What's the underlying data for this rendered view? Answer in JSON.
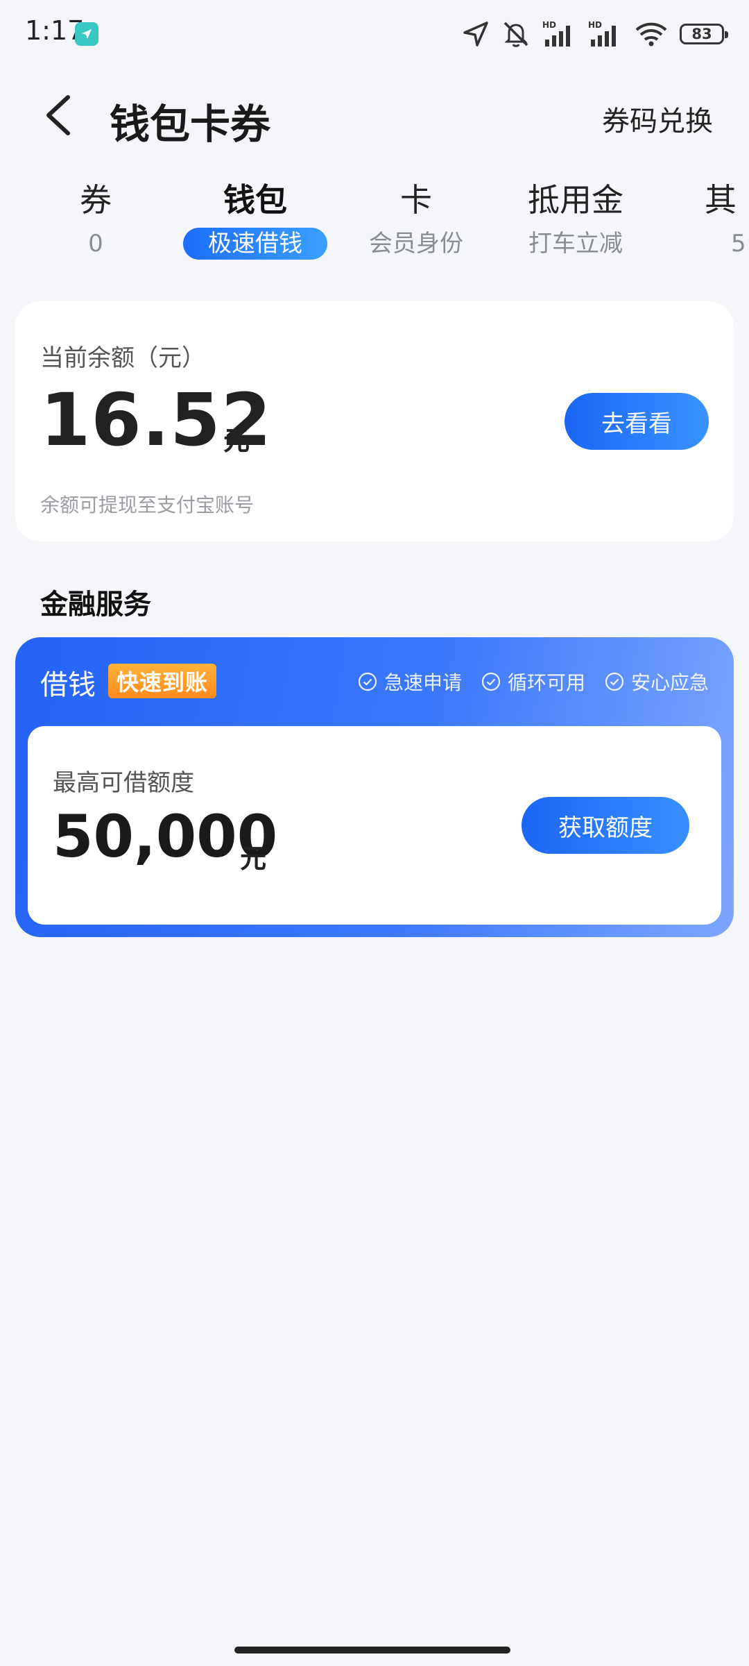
{
  "status_bar": {
    "time": "1:17",
    "battery": "83",
    "icons": [
      "location-arrow-icon",
      "mute-bell-icon",
      "signal-hd-icon",
      "signal-hd-icon",
      "wifi-icon",
      "battery-icon"
    ]
  },
  "header": {
    "title": "钱包卡券",
    "redeem_label": "券码兑换"
  },
  "tabs": [
    {
      "label": "券",
      "sub": "0"
    },
    {
      "label": "钱包",
      "sub": "极速借钱"
    },
    {
      "label": "卡",
      "sub": "会员身份"
    },
    {
      "label": "抵用金",
      "sub": "打车立减"
    },
    {
      "label": "其",
      "sub": "5"
    }
  ],
  "balance": {
    "label": "当前余额（元）",
    "amount": "16.52",
    "unit": "元",
    "button_label": "去看看",
    "note": "余额可提现至支付宝账号"
  },
  "finance": {
    "section_title": "金融服务",
    "loan_title": "借钱",
    "badge": "快速到账",
    "features": [
      "急速申请",
      "循环可用",
      "安心应急"
    ],
    "limit_label": "最高可借额度",
    "limit_amount": "50,000",
    "limit_unit": "元",
    "button_label": "获取额度"
  },
  "colors": {
    "accent": "#1d6dfb",
    "badge": "#ff9a2a",
    "background": "#f4f6f9"
  }
}
